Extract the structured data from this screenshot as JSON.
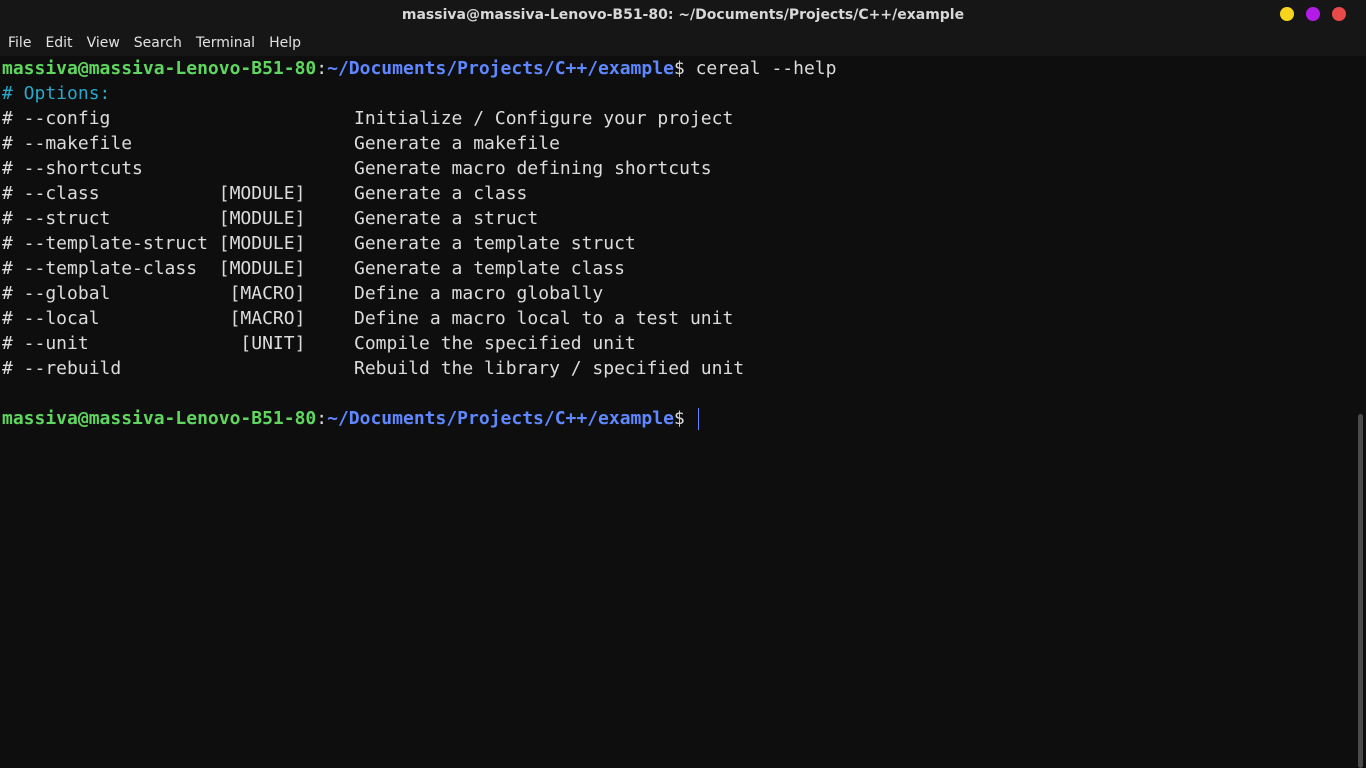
{
  "window": {
    "title": "massiva@massiva-Lenovo-B51-80: ~/Documents/Projects/C++/example",
    "buttons": [
      {
        "name": "minimize",
        "color": "#f7d51a"
      },
      {
        "name": "maximize",
        "color": "#b31ce6"
      },
      {
        "name": "close",
        "color": "#e84a4a"
      }
    ]
  },
  "menu": [
    "File",
    "Edit",
    "View",
    "Search",
    "Terminal",
    "Help"
  ],
  "prompt": {
    "user_host": "massiva@massiva-Lenovo-B51-80",
    "separator": ":",
    "path": "~/Documents/Projects/C++/example",
    "symbol": "$ "
  },
  "command": "cereal --help",
  "header": "# Options:",
  "options": [
    {
      "flag": "# --config",
      "arg": "",
      "desc": "Initialize / Configure your project"
    },
    {
      "flag": "# --makefile",
      "arg": "",
      "desc": "Generate a makefile"
    },
    {
      "flag": "# --shortcuts",
      "arg": "",
      "desc": "Generate macro defining shortcuts"
    },
    {
      "flag": "# --class           [MODULE]",
      "arg": "",
      "desc": "Generate a class"
    },
    {
      "flag": "# --struct          [MODULE]",
      "arg": "",
      "desc": "Generate a struct"
    },
    {
      "flag": "# --template-struct [MODULE]",
      "arg": "",
      "desc": "Generate a template struct"
    },
    {
      "flag": "# --template-class  [MODULE]",
      "arg": "",
      "desc": "Generate a template class"
    },
    {
      "flag": "# --global           [MACRO]",
      "arg": "",
      "desc": "Define a macro globally"
    },
    {
      "flag": "# --local            [MACRO]",
      "arg": "",
      "desc": "Define a macro local to a test unit"
    },
    {
      "flag": "# --unit              [UNIT]",
      "arg": "",
      "desc": "Compile the specified unit"
    },
    {
      "flag": "# --rebuild",
      "arg": "",
      "desc": "Rebuild the library / specified unit"
    }
  ],
  "colors": {
    "prompt_user": "#5fd75f",
    "prompt_path": "#5f87ff",
    "comment": "#2aa7c9",
    "text": "#dcdcdc",
    "background": "#0e0e0e"
  }
}
